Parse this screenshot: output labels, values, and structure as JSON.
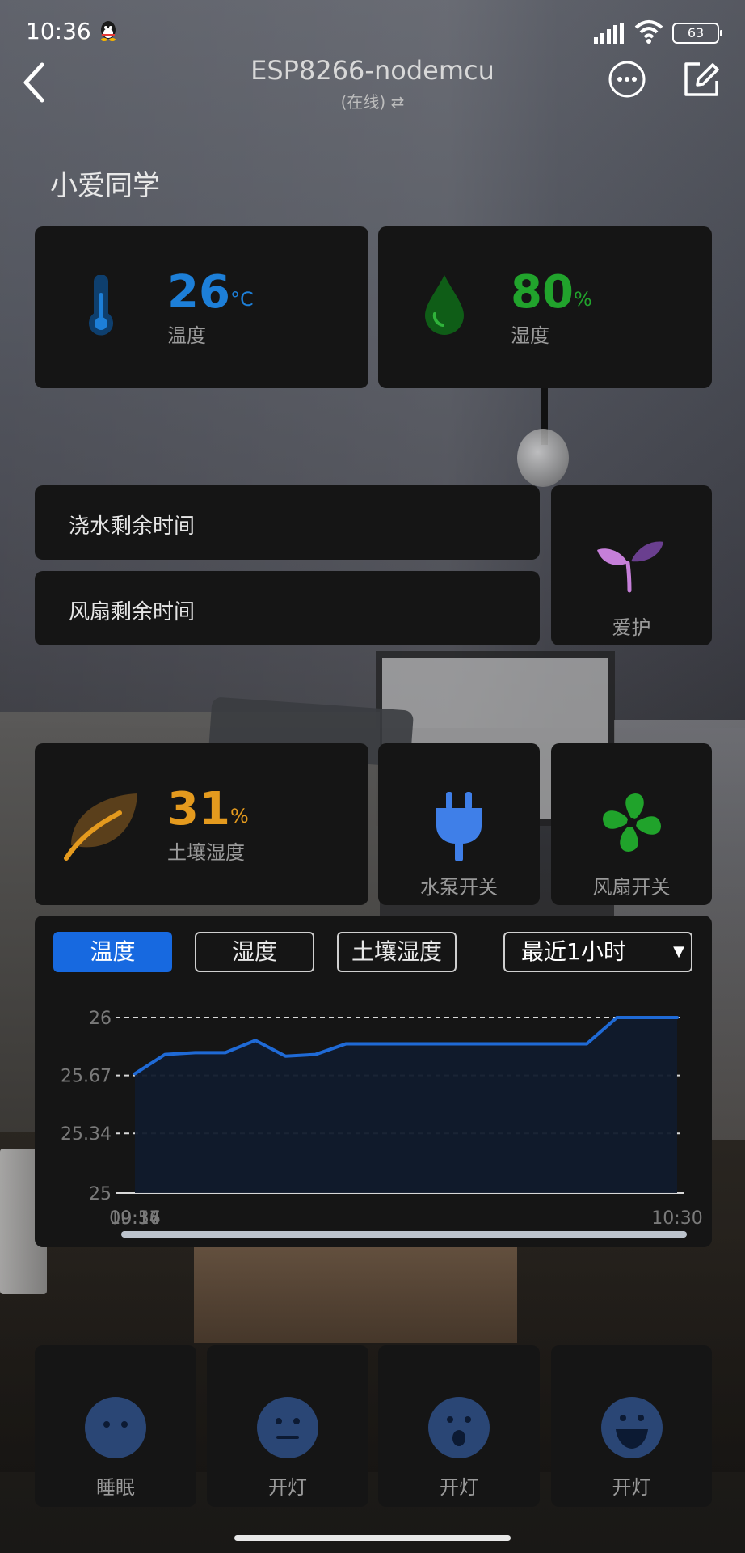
{
  "status_bar": {
    "time": "10:36",
    "battery": "63"
  },
  "nav": {
    "title": "ESP8266-nodemcu",
    "subtitle": "(在线) ⇄"
  },
  "section_title": "小爱同学",
  "sensors": {
    "temperature": {
      "value": "26",
      "unit": "°C",
      "label": "温度",
      "color": "#1d7fd8"
    },
    "humidity": {
      "value": "80",
      "unit": "%",
      "label": "湿度",
      "color": "#21a32c"
    },
    "soil": {
      "value": "31",
      "unit": "%",
      "label": "土壤湿度",
      "color": "#e49a1e"
    }
  },
  "timers": {
    "water": "浇水剩余时间",
    "fan": "风扇剩余时间"
  },
  "buttons": {
    "care": "爱护",
    "pump": "水泵开关",
    "fan": "风扇开关"
  },
  "chart_tabs": [
    "温度",
    "湿度",
    "土壤湿度"
  ],
  "chart_range": "最近1小时",
  "chart_data": {
    "type": "area",
    "x": [
      "09:37",
      "09:40",
      "09:43",
      "09:46",
      "09:49",
      "09:52",
      "09:55",
      "09:58",
      "10:01",
      "10:04",
      "10:07",
      "10:10",
      "10:13",
      "10:16",
      "10:19",
      "10:22",
      "10:25",
      "10:28",
      "10:30"
    ],
    "series": [
      {
        "values": [
          25.68,
          25.79,
          25.8,
          25.8,
          25.87,
          25.78,
          25.79,
          25.85,
          25.85,
          25.85,
          25.85,
          25.85,
          25.85,
          25.85,
          25.85,
          25.85,
          26.0,
          26.0,
          26.0
        ]
      }
    ],
    "ylim": [
      25,
      26
    ],
    "yticks": [
      "26",
      "25.67",
      "25.34",
      "25"
    ],
    "xticks": [
      "09:37",
      "09:56",
      "10:14",
      "10:30"
    ],
    "grid": true,
    "line_color": "#1f6ad6"
  },
  "scenes": [
    {
      "label": "睡眠",
      "icon": "sleep-face-icon"
    },
    {
      "label": "开灯",
      "icon": "neutral-face-icon"
    },
    {
      "label": "开灯",
      "icon": "surprised-face-icon"
    },
    {
      "label": "开灯",
      "icon": "happy-face-icon"
    }
  ]
}
